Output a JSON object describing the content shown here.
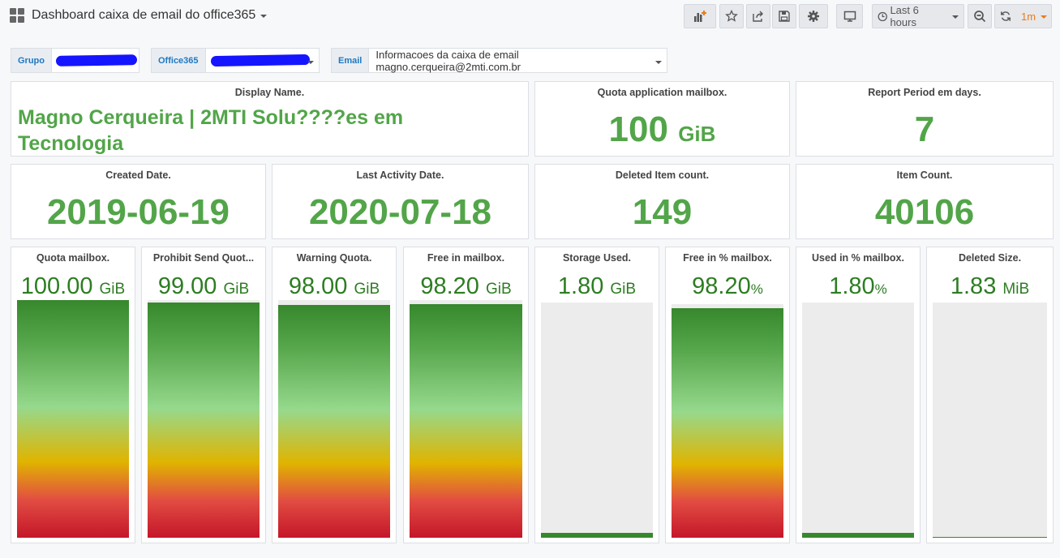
{
  "header": {
    "title": "Dashboard caixa de email do office365",
    "time_range": "Last 6 hours",
    "refresh_interval": "1m"
  },
  "variables": {
    "grupo_label": "Grupo",
    "office365_label": "Office365",
    "email_label": "Email",
    "email_value": "Informacoes da caixa de email magno.cerqueira@2mti.com.br"
  },
  "stats": {
    "display_name": {
      "title": "Display Name.",
      "value": "Magno Cerqueira | 2MTI Solu????es em Tecnologia"
    },
    "quota_app": {
      "title": "Quota application mailbox.",
      "value": "100",
      "unit": "GiB"
    },
    "report_period": {
      "title": "Report Period em days.",
      "value": "7"
    },
    "created": {
      "title": "Created Date.",
      "value": "2019-06-19"
    },
    "last_activity": {
      "title": "Last Activity Date.",
      "value": "2020-07-18"
    },
    "deleted_count": {
      "title": "Deleted Item count.",
      "value": "149"
    },
    "item_count": {
      "title": "Item Count.",
      "value": "40106"
    }
  },
  "gauges": [
    {
      "title": "Quota mailbox.",
      "value": "100.00",
      "unit": "GiB",
      "fill_fraction": 1.0
    },
    {
      "title": "Prohibit Send Quot...",
      "value": "99.00",
      "unit": "GiB",
      "fill_fraction": 0.99
    },
    {
      "title": "Warning Quota.",
      "value": "98.00",
      "unit": "GiB",
      "fill_fraction": 0.98
    },
    {
      "title": "Free in mailbox.",
      "value": "98.20",
      "unit": "GiB",
      "fill_fraction": 0.982
    },
    {
      "title": "Storage Used.",
      "value": "1.80",
      "unit": "GiB",
      "fill_fraction": 0.018
    },
    {
      "title": "Free in % mailbox.",
      "value": "98.20",
      "unit": "%",
      "fill_fraction": 0.982
    },
    {
      "title": "Used in % mailbox.",
      "value": "1.80",
      "unit": "%",
      "fill_fraction": 0.018
    },
    {
      "title": "Deleted Size.",
      "value": "1.83",
      "unit": "MiB",
      "fill_fraction": 0.002
    }
  ],
  "icons": [
    "dashboard-grid-icon",
    "add-panel-icon",
    "star-icon",
    "share-icon",
    "save-icon",
    "settings-gear-icon",
    "tv-mode-icon",
    "clock-icon",
    "zoom-out-icon",
    "refresh-icon"
  ]
}
